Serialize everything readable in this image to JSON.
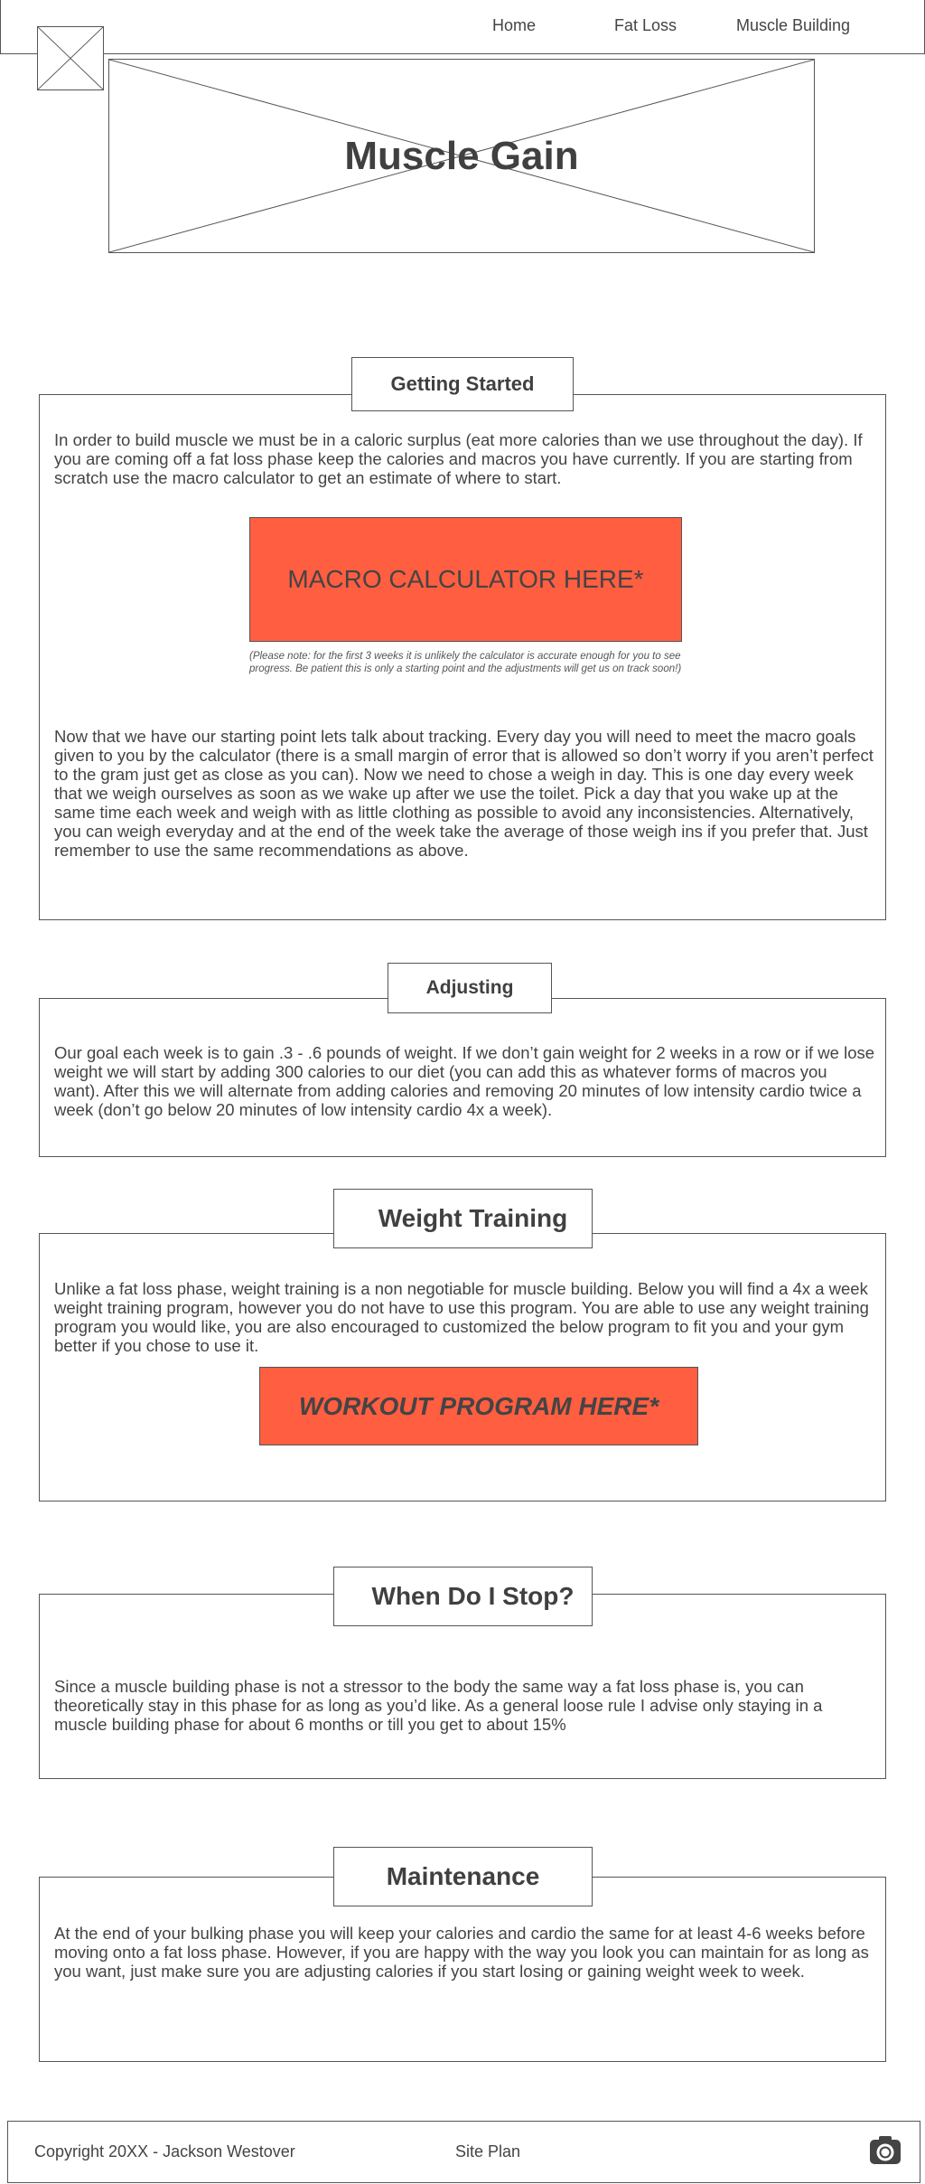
{
  "header": {
    "nav": [
      {
        "label": "Home"
      },
      {
        "label": "Fat Loss"
      },
      {
        "label": "Muscle Building"
      }
    ]
  },
  "hero": {
    "title": "Muscle Gain"
  },
  "sections": {
    "getting_started": {
      "title": "Getting Started",
      "intro": "In order to build muscle we must be in a caloric surplus (eat more calories than we use throughout the day). If you are coming off a fat loss phase keep the calories and macros you have currently. If you are starting from scratch use the macro calculator to get an estimate of where to start.",
      "cta": "MACRO CALCULATOR HERE*",
      "note": "(Please note: for the first 3 weeks it is unlikely the calculator is accurate enough for you to see progress. Be patient this is only a starting point and the adjustments will get us on track soon!)",
      "tracking": "Now that we have our starting point lets talk about tracking. Every day you will need to meet the macro goals given to you by the calculator (there is a small margin of error that is allowed so don’t worry if you aren’t perfect to the gram just get as close as you can). Now we need to chose a weigh in day. This is one day every week that we weigh ourselves as soon as we wake up after we use the toilet. Pick a day that you wake up at the same time each week and weigh with as little clothing as possible to avoid any inconsistencies. Alternatively, you can weigh everyday and at the end of the week take the average of those weigh ins if you prefer that. Just remember to use the same recommendations as above."
    },
    "adjusting": {
      "title": "Adjusting",
      "body": "Our goal each week is to gain .3 - .6 pounds of weight. If we don’t gain weight for 2 weeks in a row or if we lose weight we will start by adding 300 calories to our diet (you can add this as whatever forms of macros you want). After this we will alternate from adding calories and removing 20 minutes of low intensity cardio twice a week (don’t go below 20 minutes of low intensity cardio 4x a week)."
    },
    "weight_training": {
      "title": "Weight Training",
      "body": "Unlike a fat loss phase, weight training is a non negotiable for muscle building. Below you will find a 4x a week weight training program, however you do not have to use this program. You are able to use any weight training program you would like, you are also encouraged to customized the below program to fit you and your gym better if you chose to use it.",
      "cta": "WORKOUT PROGRAM HERE*"
    },
    "when_stop": {
      "title": "When Do I Stop?",
      "body": "Since a muscle building phase is not a stressor to the body the same way a fat loss phase is, you can theoretically stay in this phase for as long as you’d like. As a general loose rule I advise only staying in a muscle building phase for about 6 months or till you get to about 15%"
    },
    "maintenance": {
      "title": "Maintenance",
      "body": "At the end of your bulking phase you will keep your calories and cardio the same for at least 4-6 weeks before moving onto a fat loss phase. However, if you are happy with the way you look you can maintain for as long as you want, just make sure you are adjusting calories if you start losing or gaining weight week to week."
    }
  },
  "footer": {
    "copyright": "Copyright 20XX - Jackson Westover",
    "site_plan": "Site Plan",
    "icon": "camera-icon"
  },
  "colors": {
    "cta": "#ff5e40",
    "border": "#555555",
    "text": "#444444"
  }
}
